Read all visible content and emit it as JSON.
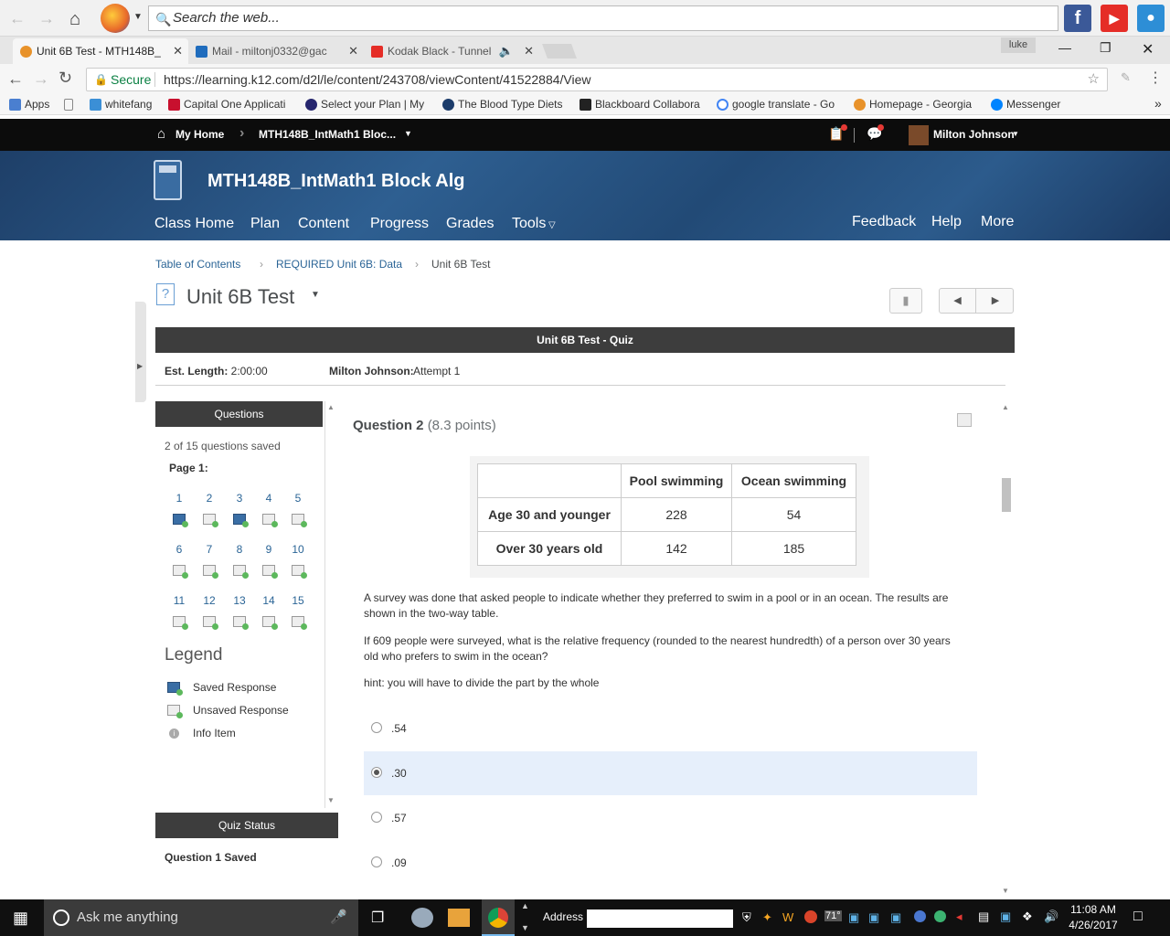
{
  "browser": {
    "search_placeholder": "Search the web...",
    "tabs": [
      {
        "title": "Unit 6B Test - MTH148B_",
        "active": true
      },
      {
        "title": "Mail - miltonj0332@gac",
        "active": false
      },
      {
        "title": "Kodak Black - Tunnel",
        "active": false
      }
    ],
    "profile_name": "luke",
    "secure_label": "Secure",
    "url": "https://learning.k12.com/d2l/le/content/243708/viewContent/41522884/View",
    "bookmarks": [
      "Apps",
      "whitefang",
      "Capital One Applicati",
      "Select your Plan | My",
      "The Blood Type Diets",
      "Blackboard Collabora",
      "google translate - Go",
      "Homepage - Georgia",
      "Messenger"
    ]
  },
  "k12nav": {
    "home": "My Home",
    "course_short": "MTH148B_IntMath1 Bloc...",
    "user": "Milton Johnson"
  },
  "course": {
    "title": "MTH148B_IntMath1 Block Alg",
    "nav": [
      "Class Home",
      "Plan",
      "Content",
      "Progress",
      "Grades",
      "Tools"
    ],
    "nav_right": [
      "Feedback",
      "Help",
      "More"
    ]
  },
  "breadcrumb": [
    "Table of Contents",
    "REQUIRED Unit 6B: Data",
    "Unit 6B Test"
  ],
  "page_title": "Unit 6B Test",
  "quiz": {
    "header": "Unit 6B Test - Quiz",
    "est_label": "Est. Length:",
    "est_value": "2:00:00",
    "attempt_name": "Milton Johnson:",
    "attempt_value": "Attempt 1"
  },
  "sidebar": {
    "header": "Questions",
    "saved_count": "2 of 15 questions saved",
    "page_label": "Page 1:",
    "questions": [
      "1",
      "2",
      "3",
      "4",
      "5",
      "6",
      "7",
      "8",
      "9",
      "10",
      "11",
      "12",
      "13",
      "14",
      "15"
    ],
    "saved": [
      1,
      3
    ],
    "legend_title": "Legend",
    "legend": [
      "Saved Response",
      "Unsaved Response",
      "Info Item"
    ],
    "status_header": "Quiz Status",
    "status_text": "Question 1 Saved"
  },
  "question": {
    "title": "Question 2",
    "points": "(8.3 points)",
    "table": {
      "headers": [
        "",
        "Pool swimming",
        "Ocean swimming"
      ],
      "rows": [
        [
          "Age 30 and younger",
          "228",
          "54"
        ],
        [
          "Over 30 years old",
          "142",
          "185"
        ]
      ]
    },
    "text1": "A survey was done that asked people to indicate whether they preferred to swim in a pool or in an ocean. The results are shown in the two-way table.",
    "text2": "If 609 people were surveyed, what is the relative frequency (rounded to the nearest hundredth) of a person over 30 years old who prefers to swim in the ocean?",
    "hint": "hint: you will have to divide the part by the whole",
    "options": [
      ".54",
      ".30",
      ".57",
      ".09"
    ],
    "selected_index": 1
  },
  "taskbar": {
    "search": "Ask me anything",
    "address_label": "Address",
    "temp": "71°",
    "time": "11:08 AM",
    "date": "4/26/2017"
  }
}
